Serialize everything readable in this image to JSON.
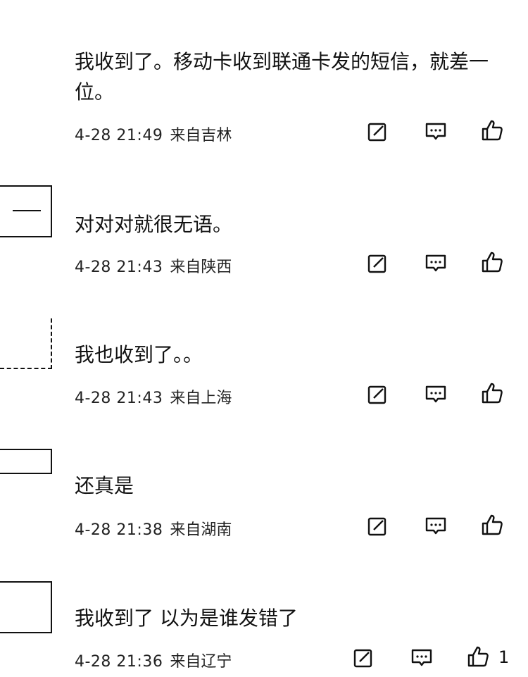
{
  "comments": [
    {
      "text": "我收到了。移动卡收到联通卡发的短信，就差一位。",
      "time": "4-28 21:49",
      "location": "来自吉林",
      "likes": ""
    },
    {
      "text": "对对对就很无语。",
      "time": "4-28 21:43",
      "location": "来自陕西",
      "likes": ""
    },
    {
      "text": "我也收到了。。",
      "time": "4-28 21:43",
      "location": "来自上海",
      "likes": ""
    },
    {
      "text": "还真是",
      "time": "4-28 21:38",
      "location": "来自湖南",
      "likes": ""
    },
    {
      "text": "我收到了 以为是谁发错了",
      "time": "4-28 21:36",
      "location": "来自辽宁",
      "likes": "1"
    }
  ],
  "icons": {
    "share": "share-icon",
    "reply": "comment-icon",
    "like": "thumbs-up-icon"
  },
  "colors": {
    "text": "#111111",
    "meta": "#222222",
    "background": "#ffffff"
  }
}
